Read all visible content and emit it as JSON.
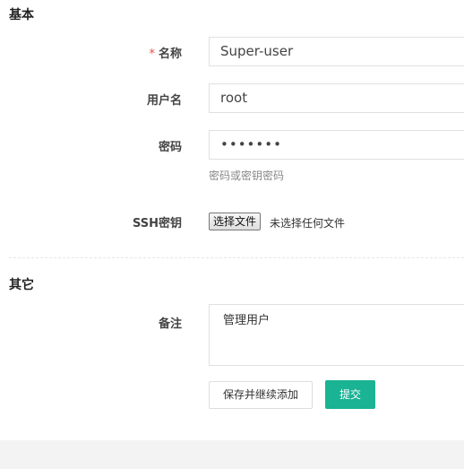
{
  "sections": {
    "basic_title": "基本",
    "other_title": "其它"
  },
  "fields": {
    "name": {
      "required_mark": "*",
      "label": "名称",
      "value": "Super-user"
    },
    "username": {
      "label": "用户名",
      "value": "root"
    },
    "password": {
      "label": "密码",
      "value": "•••••••",
      "help": "密码或密钥密码"
    },
    "ssh_key": {
      "label": "SSH密钥",
      "button": "选择文件",
      "status": "未选择任何文件"
    },
    "comment": {
      "label": "备注",
      "value": "管理用户"
    }
  },
  "actions": {
    "save_continue": "保存并继续添加",
    "submit": "提交"
  },
  "colors": {
    "primary": "#1ab394",
    "required": "#e64c4c"
  }
}
